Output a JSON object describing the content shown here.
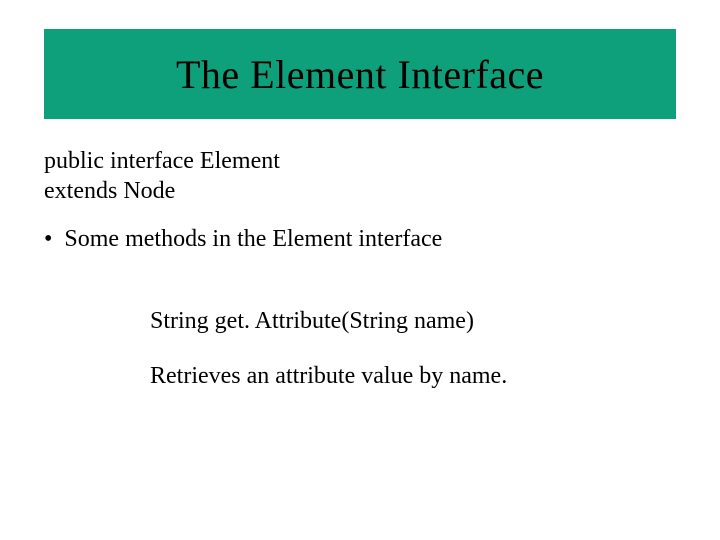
{
  "title": "The Element Interface",
  "declaration": {
    "line1": "public interface Element",
    "line2": "extends Node"
  },
  "bullet": {
    "marker": "•",
    "text": "Some methods in the Element interface"
  },
  "method": {
    "signature": "String get. Attribute(String name)",
    "description": "Retrieves an attribute value by name."
  }
}
